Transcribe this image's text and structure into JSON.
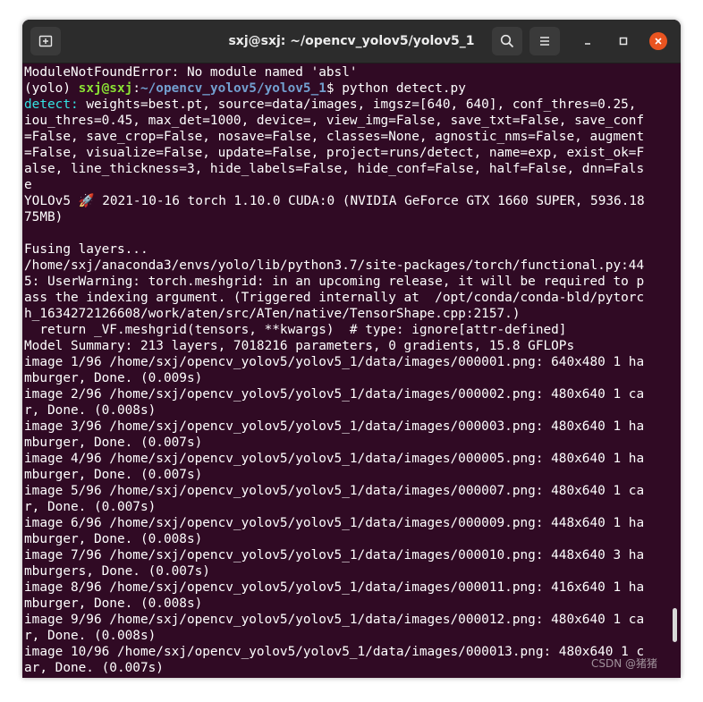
{
  "window": {
    "title": "sxj@sxj: ~/opencv_yolov5/yolov5_1",
    "new_tab_icon": "new-tab-icon",
    "search_icon": "search-icon",
    "menu_icon": "hamburger-menu-icon",
    "minimize_icon": "minimize-icon",
    "maximize_icon": "maximize-icon",
    "close_icon": "close-icon"
  },
  "terminal": {
    "error_line": "ModuleNotFoundError: No module named 'absl'",
    "prompt": {
      "env": "(yolo) ",
      "user_host": "sxj@sxj",
      "colon": ":",
      "path": "~/opencv_yolov5/yolov5_1",
      "dollar": "$ ",
      "command": "python detect.py"
    },
    "detect_label": "detect: ",
    "lines": [
      "weights=best.pt, source=data/images, imgsz=[640, 640], conf_thres=0.25,",
      "iou_thres=0.45, max_det=1000, device=, view_img=False, save_txt=False, save_conf",
      "=False, save_crop=False, nosave=False, classes=None, agnostic_nms=False, augment",
      "=False, visualize=False, update=False, project=runs/detect, name=exp, exist_ok=F",
      "alse, line_thickness=3, hide_labels=False, hide_conf=False, half=False, dnn=Fals",
      "e",
      "YOLOv5 🚀 2021-10-16 torch 1.10.0 CUDA:0 (NVIDIA GeForce GTX 1660 SUPER, 5936.18",
      "75MB)",
      "",
      "Fusing layers... ",
      "/home/sxj/anaconda3/envs/yolo/lib/python3.7/site-packages/torch/functional.py:44",
      "5: UserWarning: torch.meshgrid: in an upcoming release, it will be required to p",
      "ass the indexing argument. (Triggered internally at  /opt/conda/conda-bld/pytorc",
      "h_1634272126608/work/aten/src/ATen/native/TensorShape.cpp:2157.)",
      "  return _VF.meshgrid(tensors, **kwargs)  # type: ignore[attr-defined]",
      "Model Summary: 213 layers, 7018216 parameters, 0 gradients, 15.8 GFLOPs",
      "image 1/96 /home/sxj/opencv_yolov5/yolov5_1/data/images/000001.png: 640x480 1 ha",
      "mburger, Done. (0.009s)",
      "image 2/96 /home/sxj/opencv_yolov5/yolov5_1/data/images/000002.png: 480x640 1 ca",
      "r, Done. (0.008s)",
      "image 3/96 /home/sxj/opencv_yolov5/yolov5_1/data/images/000003.png: 480x640 1 ha",
      "mburger, Done. (0.007s)",
      "image 4/96 /home/sxj/opencv_yolov5/yolov5_1/data/images/000005.png: 480x640 1 ha",
      "mburger, Done. (0.007s)",
      "image 5/96 /home/sxj/opencv_yolov5/yolov5_1/data/images/000007.png: 480x640 1 ca",
      "r, Done. (0.007s)",
      "image 6/96 /home/sxj/opencv_yolov5/yolov5_1/data/images/000009.png: 448x640 1 ha",
      "mburger, Done. (0.008s)",
      "image 7/96 /home/sxj/opencv_yolov5/yolov5_1/data/images/000010.png: 448x640 3 ha",
      "mburgers, Done. (0.007s)",
      "image 8/96 /home/sxj/opencv_yolov5/yolov5_1/data/images/000011.png: 416x640 1 ha",
      "mburger, Done. (0.008s)",
      "image 9/96 /home/sxj/opencv_yolov5/yolov5_1/data/images/000012.png: 480x640 1 ca",
      "r, Done. (0.008s)",
      "image 10/96 /home/sxj/opencv_yolov5/yolov5_1/data/images/000013.png: 480x640 1 c",
      "ar, Done. (0.007s)"
    ]
  },
  "watermark": "CSDN @猪猪",
  "colors": {
    "terminal_bg": "#300a24",
    "titlebar_bg": "#2c2c2c",
    "prompt_user": "#8ae234",
    "prompt_path": "#729fcf",
    "detect_label": "#34e2e2",
    "close_button": "#e95420"
  }
}
